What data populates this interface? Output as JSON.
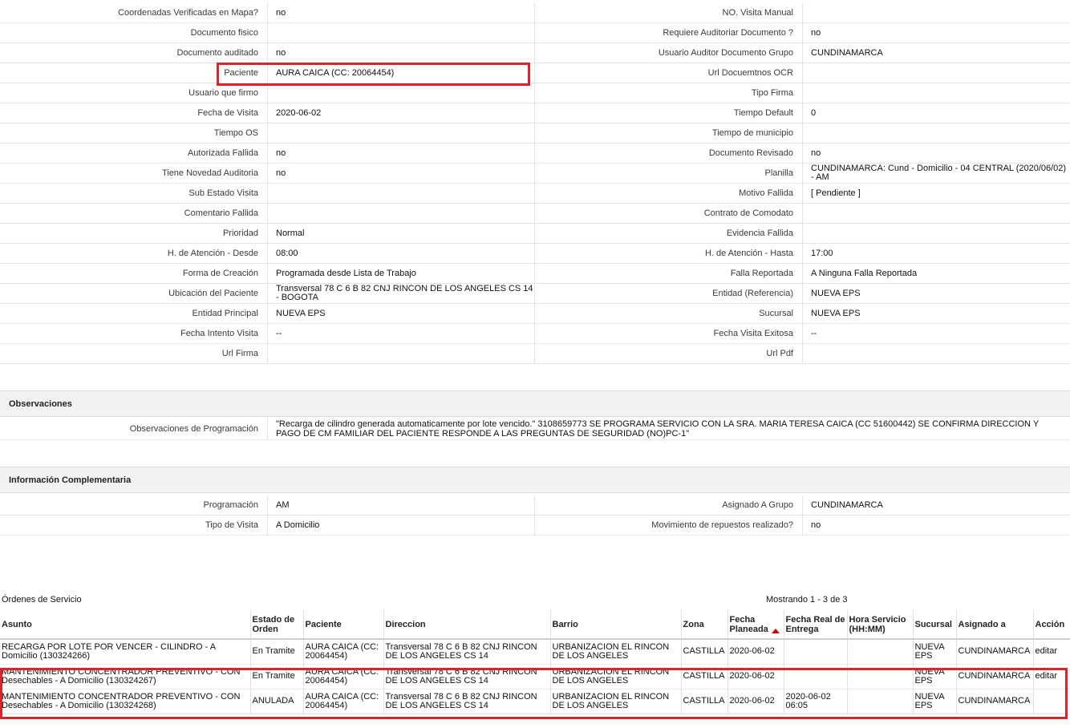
{
  "details": [
    {
      "l": "Coordenadas Verificadas en Mapa?",
      "v": "no",
      "rl": "NO. Visita Manual",
      "rv": ""
    },
    {
      "l": "Documento fisico",
      "v": "",
      "rl": "Requiere Auditoriar Documento ?",
      "rv": "no"
    },
    {
      "l": "Documento auditado",
      "v": "no",
      "rl": "Usuario Auditor Documento Grupo",
      "rv": "CUNDINAMARCA"
    },
    {
      "l": "Paciente",
      "v": "AURA CAICA (CC: 20064454)",
      "rl": "Url Docuemtnos OCR",
      "rv": ""
    },
    {
      "l": "Usuario que firmo",
      "v": "",
      "rl": "Tipo Firma",
      "rv": ""
    },
    {
      "l": "Fecha de Visita",
      "v": "2020-06-02",
      "rl": "Tiempo Default",
      "rv": "0"
    },
    {
      "l": "Tiempo OS",
      "v": "",
      "rl": "Tiempo de municipio",
      "rv": ""
    },
    {
      "l": "Autorizada Fallida",
      "v": "no",
      "rl": "Documento Revisado",
      "rv": "no"
    },
    {
      "l": "Tiene Novedad Auditoria",
      "v": "no",
      "rl": "Planilla",
      "rv": "CUNDINAMARCA: Cund - Domicilio - 04 CENTRAL (2020/06/02) - AM"
    },
    {
      "l": "Sub Estado Visita",
      "v": "",
      "rl": "Motivo Fallida",
      "rv": "[ Pendiente ]"
    },
    {
      "l": "Comentario Fallida",
      "v": "",
      "rl": "Contrato de Comodato",
      "rv": ""
    },
    {
      "l": "Prioridad",
      "v": "Normal",
      "rl": "Evidencia Fallida",
      "rv": ""
    },
    {
      "l": "H. de Atención - Desde",
      "v": "08:00",
      "rl": "H. de Atención - Hasta",
      "rv": "17:00"
    },
    {
      "l": "Forma de Creación",
      "v": "Programada desde Lista de Trabajo",
      "rl": "Falla Reportada",
      "rv": "A Ninguna Falla Reportada"
    },
    {
      "l": "Ubicación del Paciente",
      "v": "Transversal 78 C 6 B 82 CNJ RINCON DE LOS ANGELES CS 14 - BOGOTA",
      "rl": "Entidad (Referencia)",
      "rv": "NUEVA EPS"
    },
    {
      "l": "Entidad Principal",
      "v": "NUEVA EPS",
      "rl": "Sucursal",
      "rv": "NUEVA EPS"
    },
    {
      "l": "Fecha Intento Visita",
      "v": "--",
      "rl": "Fecha Visita Exitosa",
      "rv": "--"
    },
    {
      "l": "Url Firma",
      "v": "",
      "rl": "Url Pdf",
      "rv": ""
    }
  ],
  "observaciones": {
    "title": "Observaciones",
    "label": "Observaciones de Programación",
    "value": "\"Recarga de cilindro generada automaticamente por lote vencido.\" 3108659773 SE PROGRAMA SERVICIO CON LA SRA. MARIA TERESA CAICA (CC 51600442) SE CONFIRMA DIRECCION Y PAGO DE CM FAMILIAR DEL PACIENTE RESPONDE A LAS PREGUNTAS DE SEGURIDAD (NO)PC-1\""
  },
  "complementaria": {
    "title": "Información Complementaria",
    "rows": [
      {
        "l": "Programación",
        "v": "AM",
        "rl": "Asignado A Grupo",
        "rv": "CUNDINAMARCA"
      },
      {
        "l": "Tipo de Visita",
        "v": "A Domicilio",
        "rl": "Movimiento de repuestos realizado?",
        "rv": "no"
      }
    ]
  },
  "orders": {
    "title": "Órdenes de Servicio",
    "count": "Mostrando 1 - 3 de 3",
    "headers": [
      "Asunto",
      "Estado de Orden",
      "Paciente",
      "Direccion",
      "Barrio",
      "Zona",
      "Fecha Planeada",
      "Fecha Real de Entrega",
      "Hora Servicio (HH:MM)",
      "Sucursal",
      "Asignado a",
      "Acción"
    ],
    "rows": [
      [
        "RECARGA POR LOTE POR VENCER - CILINDRO - A Domicilio (130324266)",
        "En Tramite",
        "AURA CAICA (CC: 20064454)",
        "Transversal 78 C 6 B 82 CNJ RINCON DE LOS ANGELES CS 14",
        "URBANIZACION EL RINCON DE LOS ANGELES",
        "CASTILLA",
        "2020-06-02",
        "",
        "",
        "NUEVA EPS",
        "CUNDINAMARCA",
        "editar"
      ],
      [
        "MANTENIMIENTO CONCENTRADOR PREVENTIVO - CON Desechables - A Domicilio (130324267)",
        "En Tramite",
        "AURA CAICA (CC: 20064454)",
        "Transversal 78 C 6 B 82 CNJ RINCON DE LOS ANGELES CS 14",
        "URBANIZACION EL RINCON DE LOS ANGELES",
        "CASTILLA",
        "2020-06-02",
        "",
        "",
        "NUEVA EPS",
        "CUNDINAMARCA",
        "editar"
      ],
      [
        "MANTENIMIENTO CONCENTRADOR PREVENTIVO - CON Desechables - A Domicilio (130324268)",
        "ANULADA",
        "AURA CAICA (CC: 20064454)",
        "Transversal 78 C 6 B 82 CNJ RINCON DE LOS ANGELES CS 14",
        "URBANIZACION EL RINCON DE LOS ANGELES",
        "CASTILLA",
        "2020-06-02",
        "2020-06-02 06:05",
        "",
        "NUEVA EPS",
        "CUNDINAMARCA",
        ""
      ]
    ]
  },
  "highlight_color": "#e0222c"
}
